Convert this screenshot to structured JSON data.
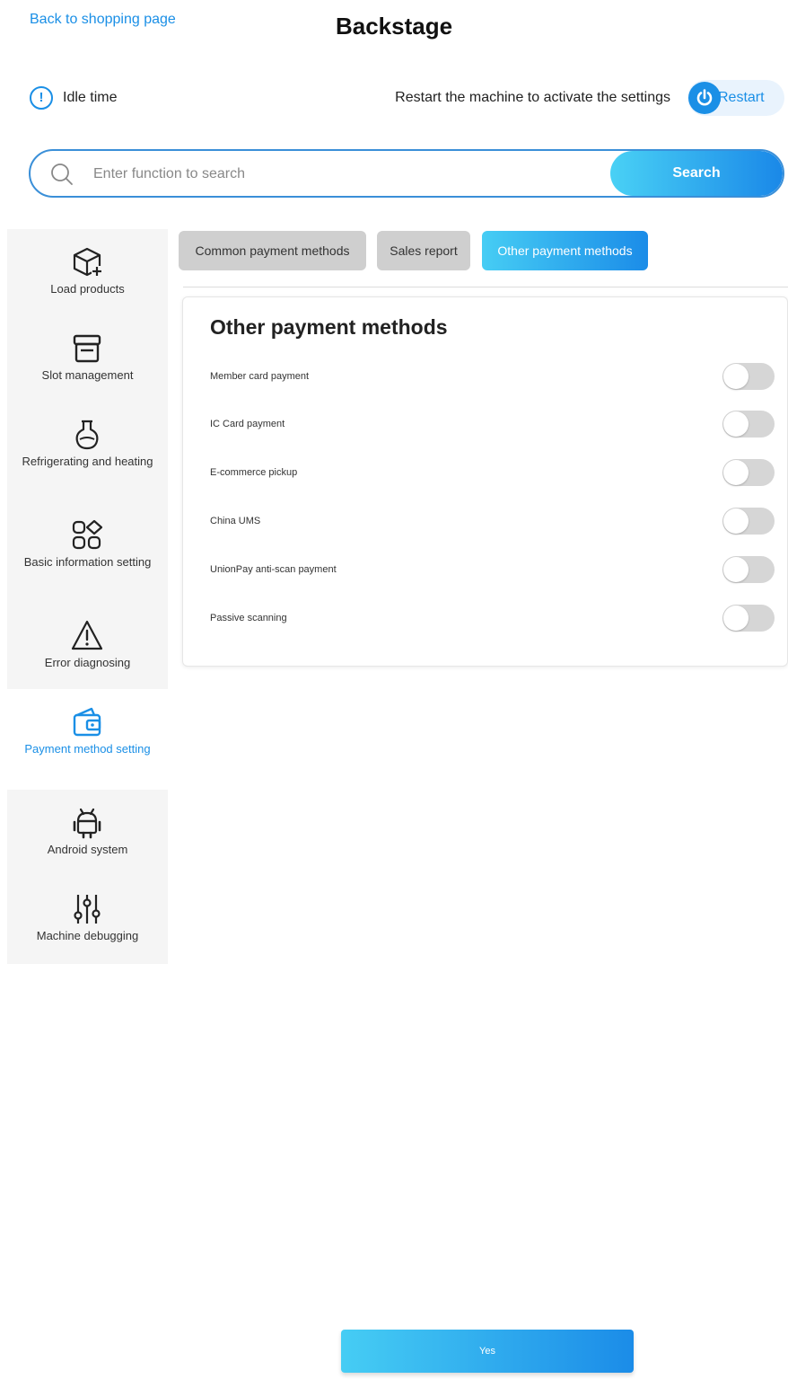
{
  "header": {
    "back_link": "Back to shopping page",
    "title": "Backstage"
  },
  "status": {
    "idle_label": "Idle time",
    "restart_note": "Restart the machine to activate the settings",
    "restart_label": "Restart"
  },
  "search": {
    "placeholder": "Enter function to search",
    "value": "",
    "button_label": "Search"
  },
  "sidebar": {
    "items": [
      {
        "label": "Load products",
        "icon": "box-plus-icon",
        "active": false
      },
      {
        "label": "Slot management",
        "icon": "archive-icon",
        "active": false
      },
      {
        "label": "Refrigerating and heating",
        "icon": "flask-icon",
        "active": false
      },
      {
        "label": "Basic information setting",
        "icon": "apps-icon",
        "active": false
      },
      {
        "label": "Error diagnosing",
        "icon": "warning-icon",
        "active": false
      },
      {
        "label": "Payment method setting",
        "icon": "wallet-icon",
        "active": true
      },
      {
        "label": "Android system",
        "icon": "android-icon",
        "active": false
      },
      {
        "label": "Machine debugging",
        "icon": "sliders-icon",
        "active": false
      }
    ]
  },
  "tabs": [
    {
      "label": "Common payment methods",
      "active": false
    },
    {
      "label": "Sales report",
      "active": false
    },
    {
      "label": "Other payment methods",
      "active": true
    }
  ],
  "panel": {
    "title": "Other payment methods",
    "options": [
      {
        "label": "Member card payment",
        "enabled": false
      },
      {
        "label": "IC Card payment",
        "enabled": false
      },
      {
        "label": "E-commerce pickup",
        "enabled": false
      },
      {
        "label": "China UMS",
        "enabled": false
      },
      {
        "label": "UnionPay anti-scan payment",
        "enabled": false
      },
      {
        "label": "Passive scanning",
        "enabled": false
      }
    ]
  },
  "footer": {
    "confirm_label": "Yes"
  },
  "colors": {
    "accent": "#1a8fe6",
    "gradient_start": "#46cdf4",
    "gradient_end": "#1b8ce8",
    "toggle_off": "#d6d6d6",
    "sidebar_bg": "#f5f5f5"
  }
}
